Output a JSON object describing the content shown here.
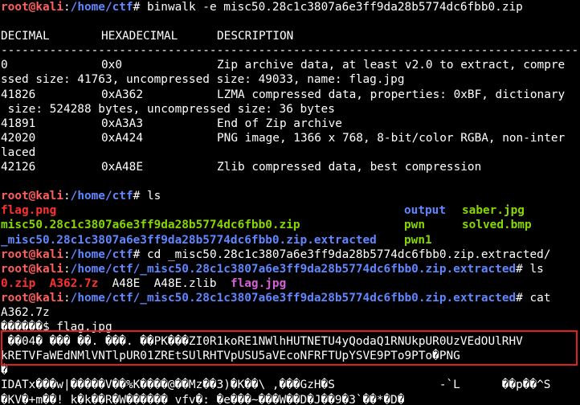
{
  "prompt": {
    "user": "root",
    "at": "@",
    "host": "kali",
    "colon": ":"
  },
  "cmd1": {
    "path": "/home/ctf",
    "symbol": "#",
    "command": " binwalk -e misc50.28c1c3807a6e3ff9da28b5774dc6fbb0.zip"
  },
  "binwalk": {
    "headers": [
      "DECIMAL",
      "HEXADECIMAL",
      "DESCRIPTION"
    ],
    "separator": "--------------------------------------------------------------------------------------------------",
    "rows": [
      {
        "dec": "0",
        "hex": "0x0",
        "desc": "Zip archive data, at least v2.0 to extract, compre",
        "cont": "ssed size: 41763, uncompressed size: 49033, name: flag.jpg"
      },
      {
        "dec": "41826",
        "hex": "0xA362",
        "desc": "LZMA compressed data, properties: 0xBF, dictionary",
        "cont": " size: 524288 bytes, uncompressed size: 36 bytes"
      },
      {
        "dec": "41891",
        "hex": "0xA3A3",
        "desc": "End of Zip archive",
        "cont": ""
      },
      {
        "dec": "42020",
        "hex": "0xA424",
        "desc": "PNG image, 1366 x 768, 8-bit/color RGBA, non-inter",
        "cont": "laced"
      },
      {
        "dec": "42126",
        "hex": "0xA48E",
        "desc": "Zlib compressed data, best compression",
        "cont": ""
      }
    ]
  },
  "cmd2": {
    "path": "/home/ctf",
    "symbol": "#",
    "command": " ls"
  },
  "ls1": {
    "col1": [
      "flag.png",
      "misc50.28c1c3807a6e3ff9da28b5774dc6fbb0.zip",
      "_misc50.28c1c3807a6e3ff9da28b5774dc6fbb0.zip.extracted"
    ],
    "col2": [
      "output",
      "pwn",
      "pwn1"
    ],
    "col3": [
      "saber.jpg",
      "solved.bmp",
      ""
    ]
  },
  "cmd3": {
    "path": "/home/ctf",
    "symbol": "#",
    "command": " cd _misc50.28c1c3807a6e3ff9da28b5774dc6fbb0.zip.extracted/"
  },
  "cmd4": {
    "path": "/home/ctf/_misc50.28c1c3807a6e3ff9da28b5774dc6fbb0.zip.extracted",
    "symbol": "#",
    "command": " ls"
  },
  "ls2": {
    "f1": "0.zip",
    "f2": "A362.7z",
    "f3": "A48E",
    "f4": "A48E.zlib",
    "f5": "flag.jpg"
  },
  "cmd5": {
    "path": "/home/ctf/_misc50.28c1c3807a6e3ff9da28b5774dc6fbb0.zip.extracted",
    "symbol": "#",
    "command": " cat",
    "cont": "A362.7z"
  },
  "cat_output": {
    "l1": "������$ flag.jpg",
    "l2": " ��04� ��� ��. ���. ��PK���ZI0R1koRE1NWlhHUTNETU4yQodaQ1RNUkpUR0UzVEdOUlRHV",
    "l3": "kRETVFaWEdNMlVNTlpUR01ZREtSUlRHTVpUSU5aVEcoNFRFTUpYSVE9PTo9PTo�PNG",
    "l4": "�",
    "l5": "IDATx���w|�����V��%K����@��Mz��3)�K��\\ ,���GzH�S               -`L      ��p��^S",
    "l6": "�KV�+m��! k�k��R�W������ vfv�: �e���~���W��D�J��9�3`��*�D�"
  },
  "colors": {
    "prompt": "#ff5f5f",
    "path": "#5f87ff",
    "archive": "#ff3030",
    "executable": "#87d700",
    "highlight_box": "#e0201c"
  }
}
